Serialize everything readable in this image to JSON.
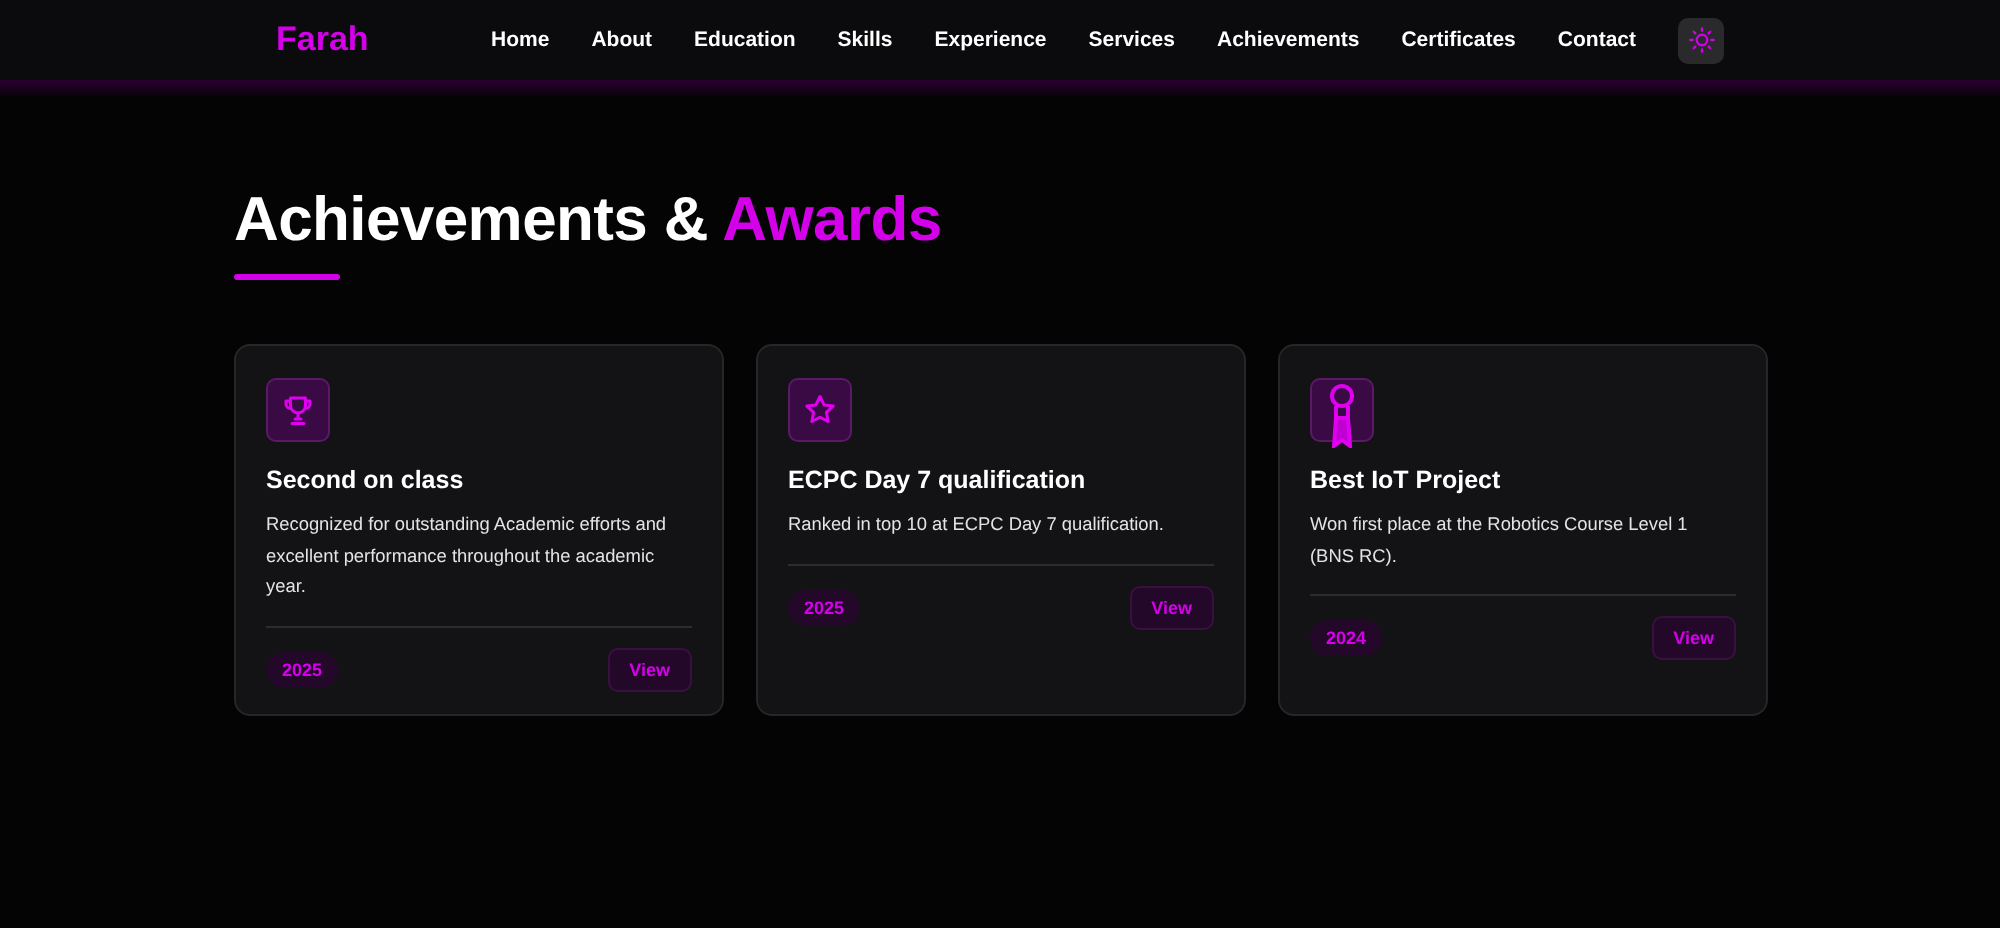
{
  "brand": "Farah",
  "nav": [
    "Home",
    "About",
    "Education",
    "Skills",
    "Experience",
    "Services",
    "Achievements",
    "Certificates",
    "Contact"
  ],
  "heading": {
    "text": "Achievements &",
    "highlight": "Awards"
  },
  "cards": [
    {
      "title": "Second on class",
      "description": "Recognized for outstanding Academic efforts and excellent performance throughout the academic year.",
      "year": "2025",
      "action": "View"
    },
    {
      "title": "ECPC Day 7 qualification",
      "description": "Ranked in top 10 at ECPC Day 7 qualification.",
      "year": "2025",
      "action": "View"
    },
    {
      "title": "Best IoT Project",
      "description": "Won first place at the Robotics Course Level 1 (BNS RC).",
      "year": "2024",
      "action": "View"
    }
  ]
}
